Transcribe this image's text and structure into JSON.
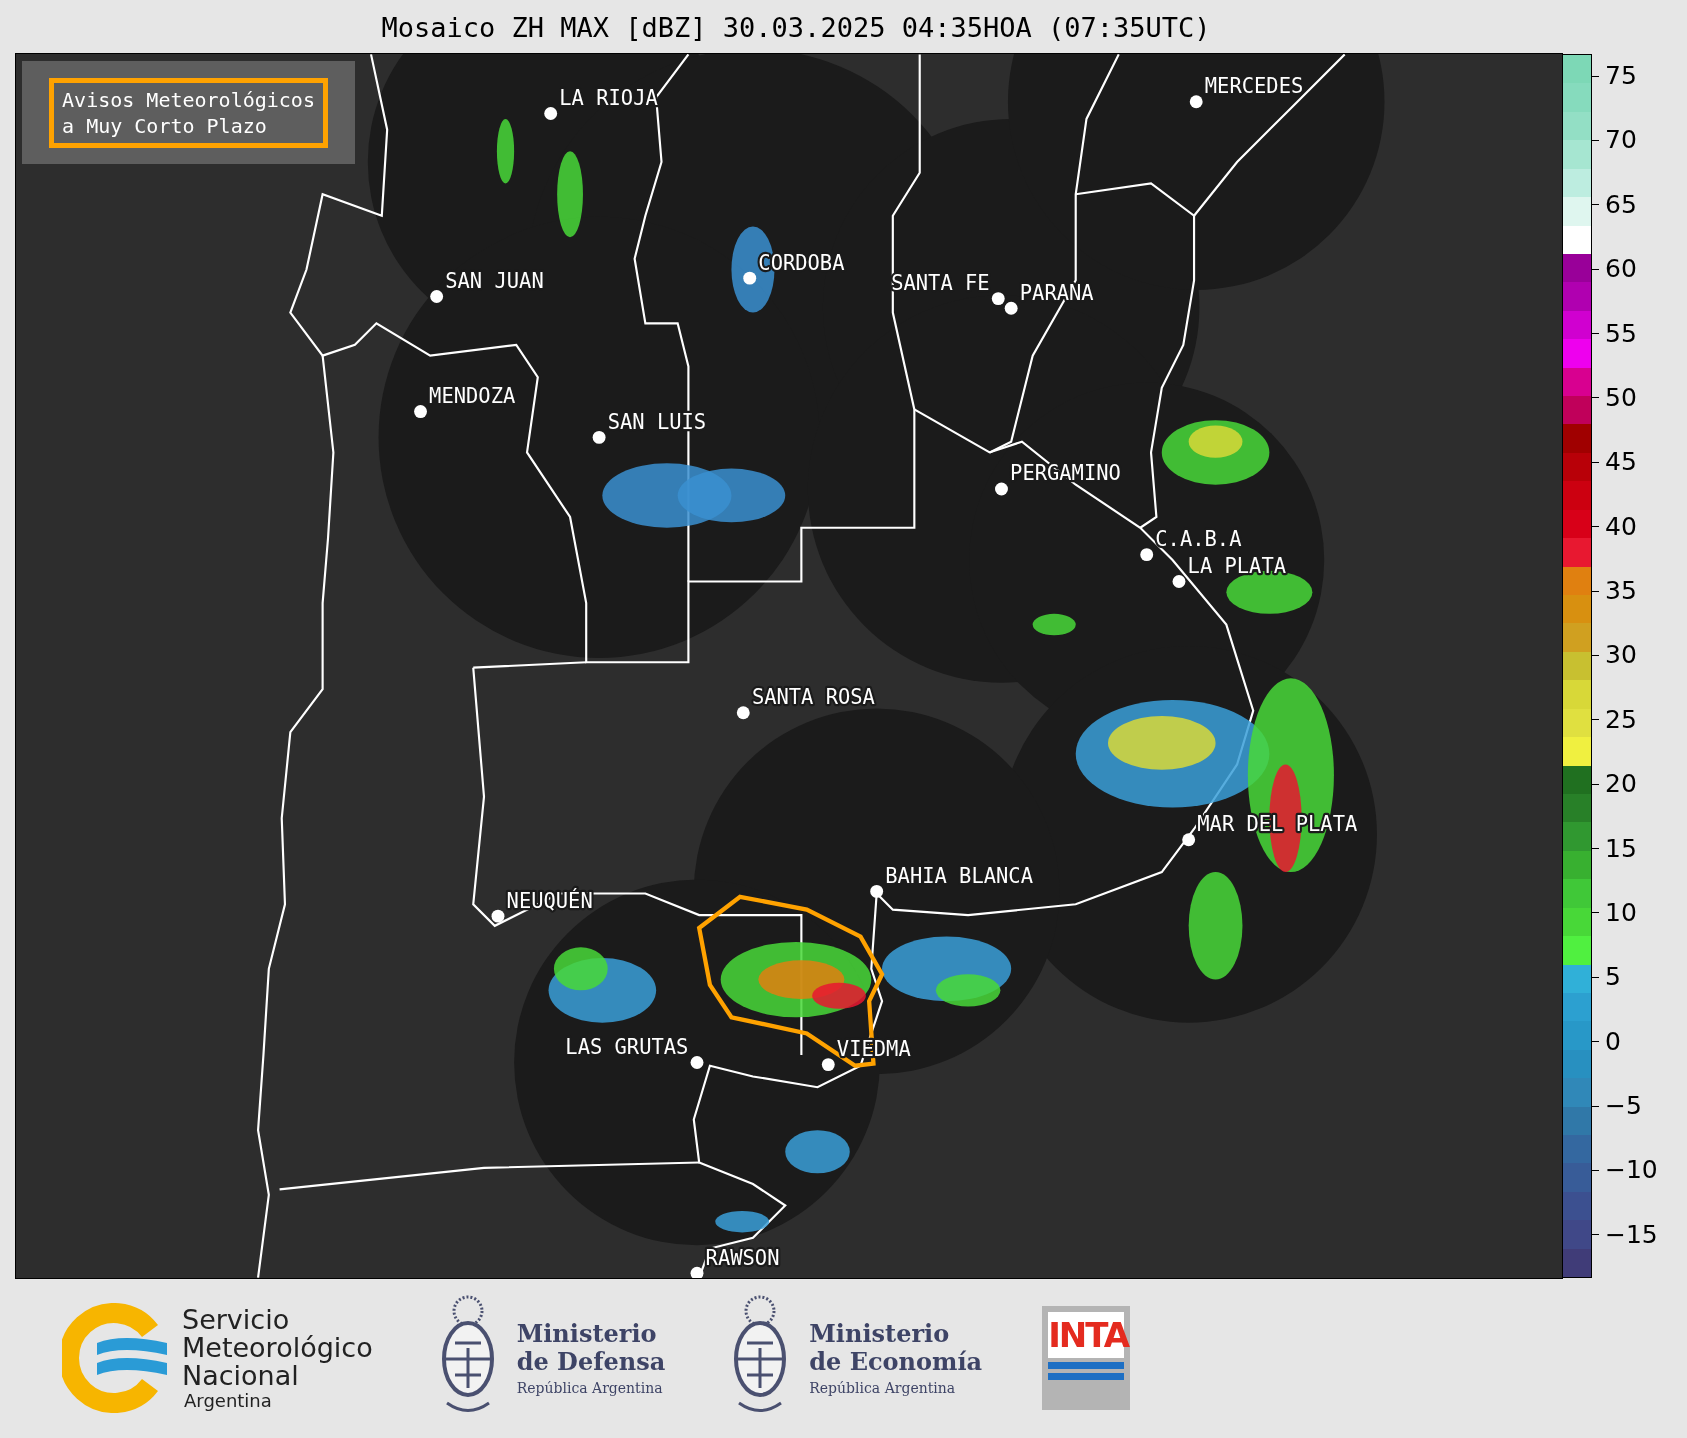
{
  "title": "Mosaico ZH MAX [dBZ] 30.03.2025 04:35HOA (07:35UTC)",
  "warning_box": {
    "text": "Avisos Meteorológicos a Muy Corto Plazo"
  },
  "cities": [
    {
      "name": "LA RIOJA"
    },
    {
      "name": "MERCEDES"
    },
    {
      "name": "CORDOBA"
    },
    {
      "name": "SAN JUAN"
    },
    {
      "name": "SANTA FE"
    },
    {
      "name": "PARANA"
    },
    {
      "name": "MENDOZA"
    },
    {
      "name": "SAN LUIS"
    },
    {
      "name": "PERGAMINO"
    },
    {
      "name": "C.A.B.A"
    },
    {
      "name": "LA PLATA"
    },
    {
      "name": "SANTA ROSA"
    },
    {
      "name": "MAR DEL PLATA"
    },
    {
      "name": "BAHIA BLANCA"
    },
    {
      "name": "NEUQUÉN"
    },
    {
      "name": "LAS GRUTAS"
    },
    {
      "name": "VIEDMA"
    },
    {
      "name": "RAWSON"
    }
  ],
  "colorbar": {
    "ticks": [
      "75",
      "70",
      "65",
      "60",
      "55",
      "50",
      "45",
      "40",
      "35",
      "30",
      "25",
      "20",
      "15",
      "10",
      "5",
      "0",
      "−5",
      "−10",
      "−15"
    ],
    "segments": [
      {
        "color": "#7dd8b6"
      },
      {
        "color": "#86dbbd"
      },
      {
        "color": "#93dfc5"
      },
      {
        "color": "#a6e6d1"
      },
      {
        "color": "#bdede0"
      },
      {
        "color": "#dff6ef"
      },
      {
        "color": "#ffffff"
      },
      {
        "color": "#990099"
      },
      {
        "color": "#b000b0"
      },
      {
        "color": "#d000d0"
      },
      {
        "color": "#ee00ee"
      },
      {
        "color": "#d80090"
      },
      {
        "color": "#c0005a"
      },
      {
        "color": "#a00000"
      },
      {
        "color": "#b80008"
      },
      {
        "color": "#cc0010"
      },
      {
        "color": "#d80018"
      },
      {
        "color": "#e81830"
      },
      {
        "color": "#e08010"
      },
      {
        "color": "#d89010"
      },
      {
        "color": "#d0a020"
      },
      {
        "color": "#c8c030"
      },
      {
        "color": "#d8d838"
      },
      {
        "color": "#e0e040"
      },
      {
        "color": "#f0f040"
      },
      {
        "color": "#207020"
      },
      {
        "color": "#288028"
      },
      {
        "color": "#309830"
      },
      {
        "color": "#38b030"
      },
      {
        "color": "#40c838"
      },
      {
        "color": "#48d838"
      },
      {
        "color": "#50f040"
      },
      {
        "color": "#30b0d8"
      },
      {
        "color": "#2ca0d0"
      },
      {
        "color": "#2898c8"
      },
      {
        "color": "#2890c0"
      },
      {
        "color": "#3088b8"
      },
      {
        "color": "#3078a8"
      },
      {
        "color": "#3468a0"
      },
      {
        "color": "#385c98"
      },
      {
        "color": "#3c5090"
      },
      {
        "color": "#404888"
      },
      {
        "color": "#403c78"
      }
    ]
  },
  "footer_logos": [
    {
      "kind": "smn",
      "lines": [
        "Servicio",
        "Meteorológico",
        "Nacional",
        "Argentina"
      ]
    },
    {
      "kind": "ministry",
      "lines": [
        "Ministerio",
        "de Defensa",
        "República Argentina"
      ]
    },
    {
      "kind": "ministry",
      "lines": [
        "Ministerio",
        "de Economía",
        "República Argentina"
      ]
    },
    {
      "kind": "inta",
      "lines": [
        "INTA"
      ]
    }
  ]
}
